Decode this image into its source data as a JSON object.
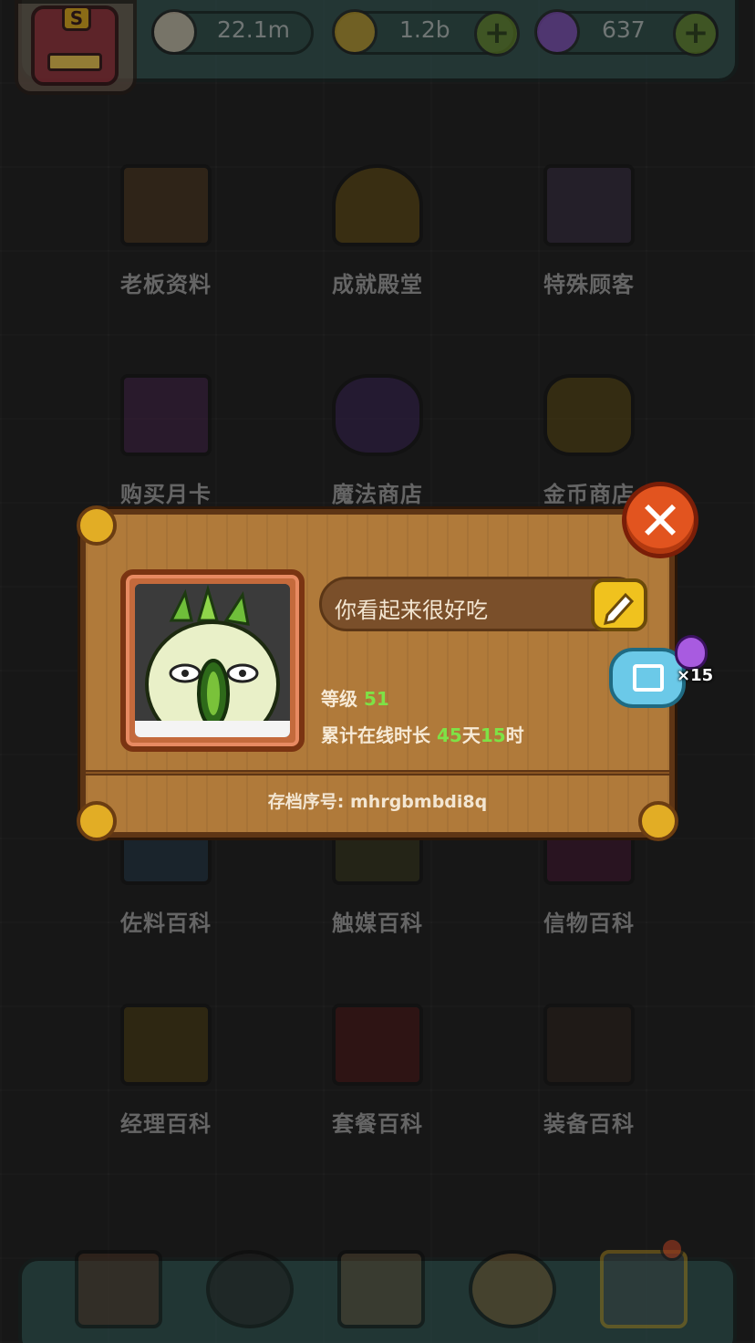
{
  "resources": {
    "eye_value": "22.1m",
    "coin_value": "1.2b",
    "potion_value": "637",
    "plus_label": "+"
  },
  "avatar": {
    "letter": "S"
  },
  "menu": [
    {
      "label": "老板资料",
      "icon": "boss-profile-icon"
    },
    {
      "label": "成就殿堂",
      "icon": "trophy-icon"
    },
    {
      "label": "特殊顾客",
      "icon": "special-customer-icon"
    },
    {
      "label": "购买月卡",
      "icon": "monthly-card-icon"
    },
    {
      "label": "魔法商店",
      "icon": "magic-shop-icon"
    },
    {
      "label": "金币商店",
      "icon": "coin-shop-icon"
    },
    {
      "label": "佐料百科",
      "icon": "seasoning-book-icon"
    },
    {
      "label": "触媒百科",
      "icon": "catalyst-book-icon"
    },
    {
      "label": "信物百科",
      "icon": "token-book-icon"
    },
    {
      "label": "经理百科",
      "icon": "manager-book-icon"
    },
    {
      "label": "套餐百科",
      "icon": "meal-book-icon"
    },
    {
      "label": "装备百科",
      "icon": "equipment-book-icon"
    }
  ],
  "dialog": {
    "name": "你看起来很好吃",
    "level_label": "等级",
    "level_value": "51",
    "online_label": "累计在线时长",
    "online_days": "45",
    "days_unit": "天",
    "online_hours": "15",
    "hours_unit": "时",
    "serial_label": "存档序号:",
    "serial_value": "mhrgbmbdi8q",
    "close_symbol": "✕",
    "share_reward": "×15"
  },
  "colors": {
    "accent_green": "#7ee246",
    "panel_wood": "#b07a3a",
    "close_red": "#e2541f",
    "edit_yellow": "#f0c21e"
  }
}
